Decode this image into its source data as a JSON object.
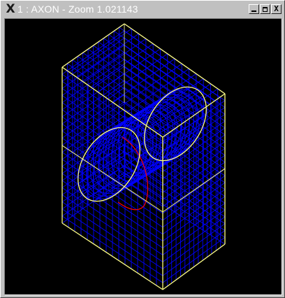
{
  "window": {
    "title": "1 : AXON - Zoom 1.021143",
    "logo_glyph": "X",
    "minimize_glyph": "_",
    "maximize_glyph": "□",
    "close_glyph": "X"
  },
  "viewport": {
    "background": "#000000",
    "mesh_color": "#0000ff",
    "outline_color": "#ffff80",
    "highlight_curve_color": "#ff0000"
  },
  "icons": {
    "logo": "x-window-logo-icon",
    "minimize": "minimize-icon",
    "maximize": "maximize-icon",
    "close": "close-icon"
  }
}
